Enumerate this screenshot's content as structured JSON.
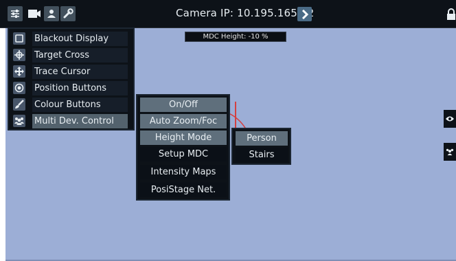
{
  "topbar": {
    "camera_label": "Camera IP: 10.195.165.22",
    "icons": [
      "sliders-icon",
      "video-camera-icon",
      "user-icon",
      "wrench-icon",
      "next-arrow-icon",
      "lock-icon"
    ]
  },
  "overlay": {
    "mdc_height": "MDC Height: -10 %"
  },
  "menu1": {
    "items": [
      {
        "label": "Blackout Display",
        "icon": "square-icon"
      },
      {
        "label": "Target Cross",
        "icon": "target-cross-icon"
      },
      {
        "label": "Trace Cursor",
        "icon": "move-cursor-icon"
      },
      {
        "label": "Position Buttons",
        "icon": "position-dot-icon"
      },
      {
        "label": "Colour Buttons",
        "icon": "paintbrush-icon"
      },
      {
        "label": "Multi Dev. Control",
        "icon": "group-users-icon",
        "active": true
      }
    ]
  },
  "menu2": {
    "items": [
      {
        "label": "On/Off",
        "active": true
      },
      {
        "label": "Auto Zoom/Foc",
        "active": true
      },
      {
        "label": "Height Mode",
        "active": true
      },
      {
        "label": "Setup MDC",
        "active": false
      },
      {
        "label": "Intensity Maps",
        "active": false
      },
      {
        "label": "PosiStage Net.",
        "active": false
      }
    ]
  },
  "menu3": {
    "items": [
      {
        "label": "Person",
        "active": true
      },
      {
        "label": "Stairs",
        "active": false
      }
    ]
  },
  "colors": {
    "background": "#9caed6",
    "panel": "#0d1218",
    "active_button": "#5f6f7c",
    "accent_red": "#d44040"
  }
}
